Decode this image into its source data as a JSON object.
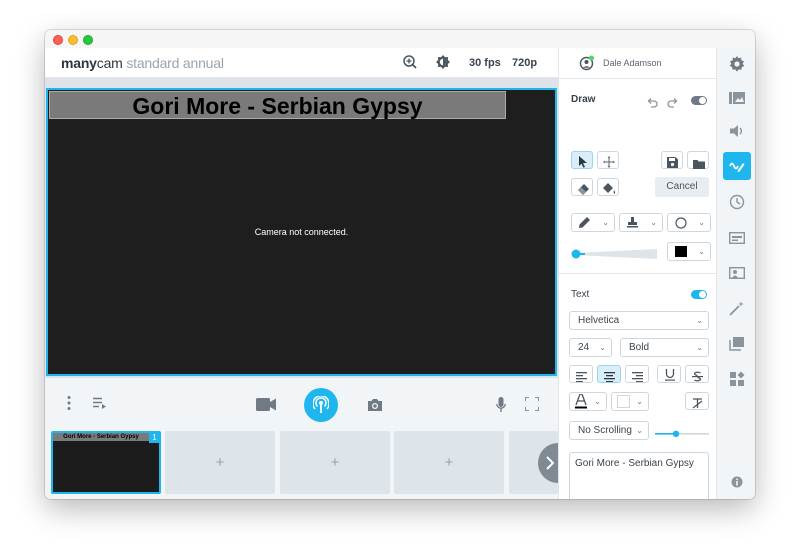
{
  "app": {
    "logo_bold": "many",
    "logo_light": "cam",
    "edition": " standard annual"
  },
  "topbar": {
    "fps": "30 fps",
    "resolution": "720p",
    "zoom_icon": "zoom-in-icon",
    "brightness_icon": "brightness-icon"
  },
  "user": {
    "name": "Dale Adamson",
    "status_color": "#4cd964"
  },
  "preview": {
    "banner_text": "Gori More - Serbian Gypsy",
    "status_message": "Camera not connected."
  },
  "thumbnails": {
    "active_title": "Gori More - Serbian Gypsy",
    "active_badge": "1",
    "empty_label": "+"
  },
  "draw": {
    "title": "Draw",
    "cancel_label": "Cancel",
    "toggle_on": false
  },
  "text_section": {
    "title": "Text",
    "toggle_on": true,
    "font": "Helvetica",
    "size": "24",
    "weight": "Bold",
    "alignment": "center",
    "scrolling": "No Scrolling",
    "content": "Gori More - Serbian Gypsy"
  },
  "colors": {
    "accent": "#1fb6ee",
    "brush_color": "#000000"
  },
  "sidebar": {
    "active_item": "draw"
  }
}
